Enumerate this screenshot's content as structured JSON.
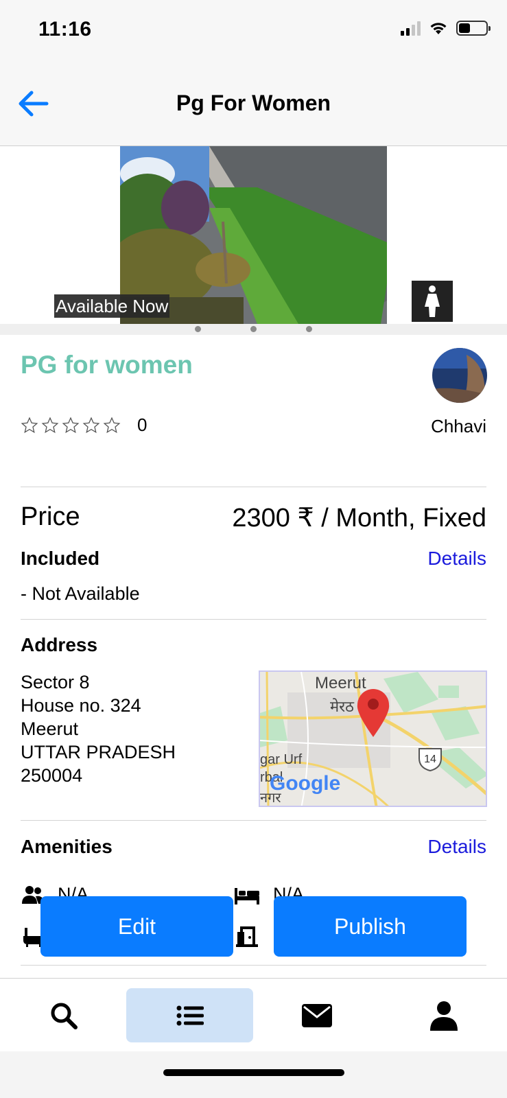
{
  "status_bar": {
    "time": "11:16"
  },
  "header": {
    "title": "Pg For Women",
    "back_icon": "arrow-left-icon"
  },
  "gallery": {
    "badge": "Available Now",
    "gender_icon": "female-person-icon",
    "page_dots": 3
  },
  "listing": {
    "title": "PG for women",
    "rating_count": "0",
    "owner_name": "Chhavi",
    "stars_filled": 0,
    "stars_total": 5
  },
  "price": {
    "label": "Price",
    "value": "2300 ₹ / Month, Fixed"
  },
  "included": {
    "heading": "Included",
    "details_label": "Details",
    "item": "- Not Available"
  },
  "address": {
    "heading": "Address",
    "lines": [
      "Sector 8",
      "House no. 324",
      "Meerut",
      "UTTAR PRADESH",
      "250004"
    ],
    "map": {
      "city_label": "Meerut",
      "city_label_hindi": "मेरठ",
      "place_label": "gar Urf",
      "place_label2": "rbal",
      "place_label3": "नगर",
      "road_number": "14",
      "brand": "Google"
    }
  },
  "amenities": {
    "heading": "Amenities",
    "details_label": "Details",
    "items": [
      {
        "icon": "people-icon",
        "value": "N/A"
      },
      {
        "icon": "bed-icon",
        "value": "N/A"
      },
      {
        "icon": "bathtub-icon",
        "value": ""
      },
      {
        "icon": "door-icon",
        "value": ""
      }
    ]
  },
  "actions": {
    "edit_label": "Edit",
    "publish_label": "Publish"
  },
  "tab_bar": {
    "tabs": [
      {
        "icon": "search-icon",
        "active": false
      },
      {
        "icon": "list-icon",
        "active": true
      },
      {
        "icon": "mail-icon",
        "active": false
      },
      {
        "icon": "profile-icon",
        "active": false
      }
    ]
  },
  "colors": {
    "accent": "#0a7cff",
    "title_teal": "#6cc5b0",
    "link_blue": "#1a1adc",
    "active_tab": "#cfe2f7"
  }
}
